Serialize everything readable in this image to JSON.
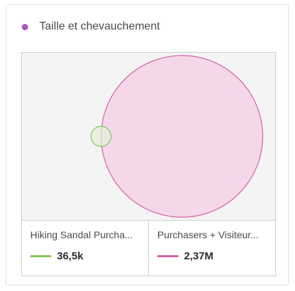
{
  "header": {
    "title": "Taille et chevauchement",
    "dot_color": "#a85bb4"
  },
  "chart_data": {
    "type": "venn",
    "title": "Taille et chevauchement",
    "series": [
      {
        "name": "Hiking Sandal Purcha...",
        "display_value": "36,5k",
        "value": 36500,
        "stroke": "#86c45c",
        "fill": "#e4f0d8"
      },
      {
        "name": "Purchasers + Visiteur...",
        "display_value": "2,37M",
        "value": 2370000,
        "stroke": "#d65fa8",
        "fill": "#f4d8ea"
      }
    ],
    "overlap": "partial"
  }
}
